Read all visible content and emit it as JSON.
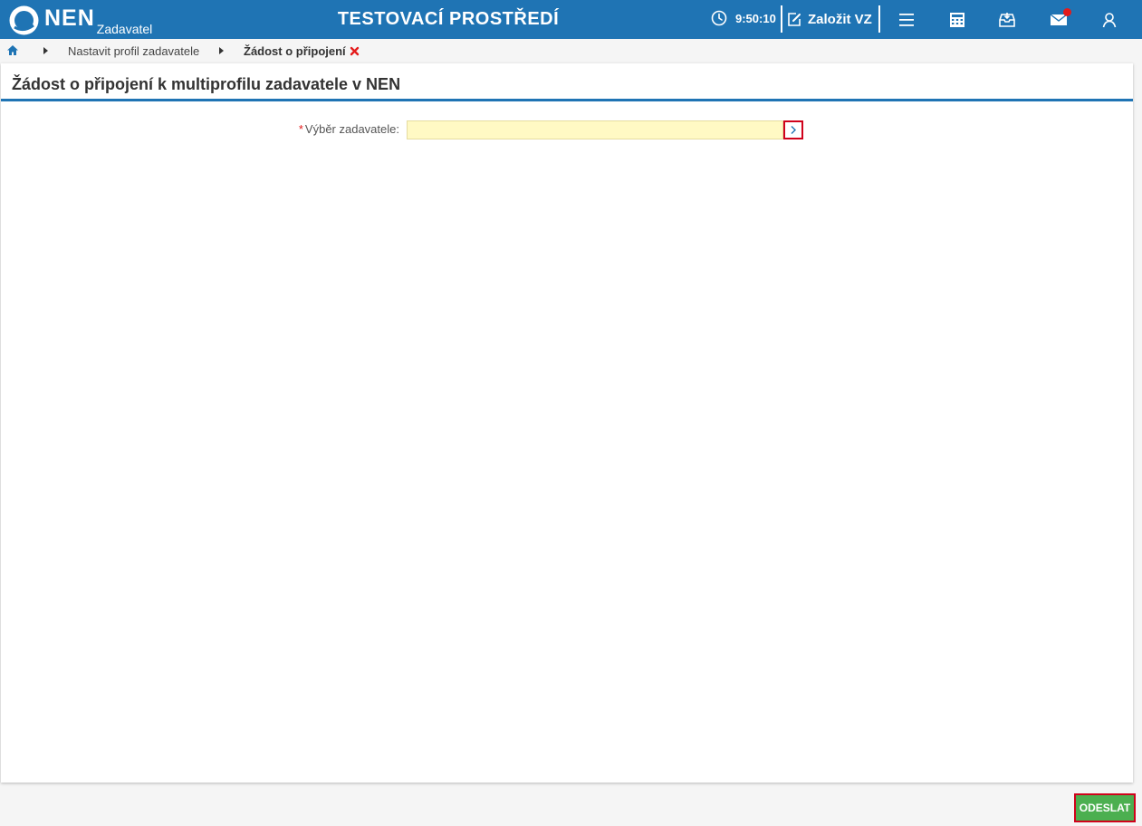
{
  "header": {
    "logo_text": "NEN",
    "logo_sub": "Zadavatel",
    "environment": "TESTOVACÍ PROSTŘEDÍ",
    "clock": "9:50:10",
    "create_label": "Založit VZ",
    "icons": [
      "clock-icon",
      "edit-icon",
      "menu-icon",
      "calculator-icon",
      "inbox-icon",
      "mail-icon",
      "user-icon"
    ],
    "colors": {
      "bar": "#1f74b4",
      "notification": "#e41b1b"
    }
  },
  "breadcrumb": {
    "items": [
      "Nastavit profil zadavatele",
      "Žádost o připojení"
    ]
  },
  "page": {
    "title": "Žádost o připojení k multiprofilu zadavatele v NEN",
    "form": {
      "required_mark": "*",
      "label": "Výběr zadavatele",
      "colon": ":",
      "value": ""
    }
  },
  "footer": {
    "submit_label": "ODESLAT",
    "submit_color": "#4caf50"
  }
}
